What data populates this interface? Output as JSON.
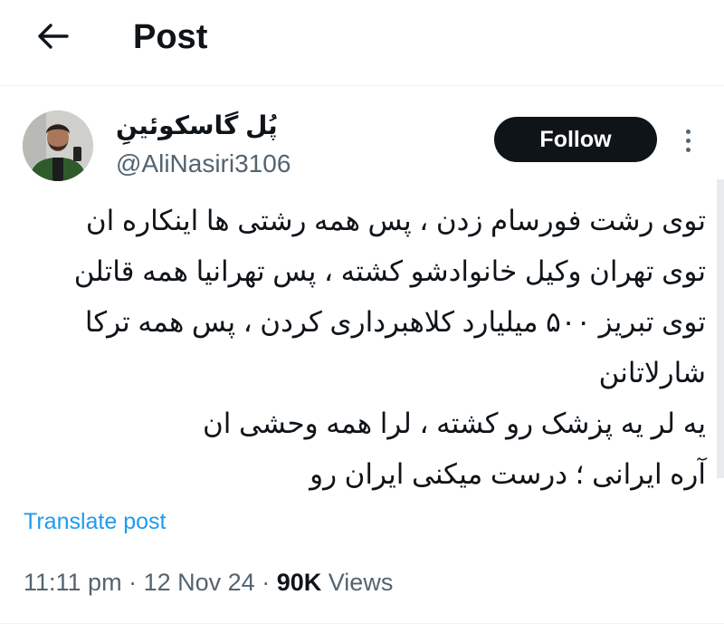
{
  "header": {
    "back_icon": "arrow-left-icon",
    "title": "Post"
  },
  "author": {
    "display_name": "پُل گاسکوئینِ",
    "handle": "@AliNasiri3106",
    "avatar": "user-avatar"
  },
  "actions": {
    "follow_label": "Follow",
    "more_icon": "more-vertical-icon"
  },
  "tweet": {
    "lines": [
      "توی رشت فورسام زدن ، پس همه رشتی ها اینکاره ان",
      "توی تهران وکیل خانوادشو کشته ، پس تهرانیا همه قاتلن",
      "توی تبریز ۵۰۰ میلیارد کلاهبرداری کردن ، پس همه ترکا",
      "شارلاتانن",
      "یه لر یه پزشک رو کشته ، لرا همه وحشی ان",
      "آره ایرانی ؛ درست میکنی ایران رو"
    ],
    "translate_label": "Translate post"
  },
  "meta": {
    "time": "11:11 pm",
    "separator": "·",
    "date": "12 Nov 24",
    "views_count": "90K",
    "views_label": "Views"
  },
  "colors": {
    "text": "#0f1419",
    "muted": "#536471",
    "link": "#1d9bf0",
    "follow_bg": "#0f1419",
    "divider": "#eff3f4"
  }
}
